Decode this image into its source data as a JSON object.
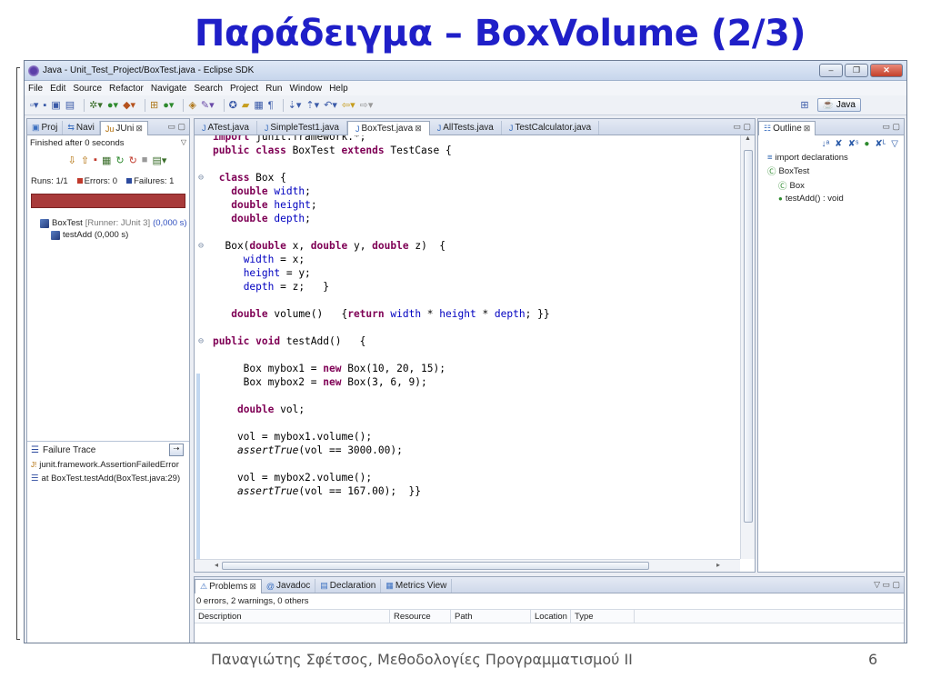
{
  "slide": {
    "title": "Παράδειγμα – BoxVolume  (2/3)",
    "footer": "Παναγιώτης Σφέτσος,  Μεθοδολογίες Προγραμματισμού ΙΙ",
    "page": "6"
  },
  "window": {
    "title": "Java - Unit_Test_Project/BoxTest.java - Eclipse SDK",
    "controls": [
      "–",
      "❐",
      "✕"
    ]
  },
  "menu": [
    "File",
    "Edit",
    "Source",
    "Refactor",
    "Navigate",
    "Search",
    "Project",
    "Run",
    "Window",
    "Help"
  ],
  "perspective": {
    "label": "Java"
  },
  "left_pane": {
    "tabs": [
      {
        "label": "Proj",
        "icon": "project-icon"
      },
      {
        "label": "Navi",
        "icon": "navigator-icon"
      },
      {
        "label": "JUni",
        "icon": "junit-icon"
      }
    ],
    "status": "Finished after 0 seconds",
    "runs": "Runs:  1/1",
    "errors": "Errors:  0",
    "failures": "Failures:  1",
    "bar_color": "#a83a3a",
    "tree": [
      {
        "name": "BoxTest",
        "detail": "[Runner: JUnit 3]",
        "time": "(0,000 s)"
      },
      {
        "name": "testAdd (0,000 s)",
        "detail": "",
        "time": ""
      }
    ],
    "failure_trace": {
      "label": "Failure Trace",
      "lines": [
        "junit.framework.AssertionFailedError",
        "at BoxTest.testAdd(BoxTest.java:29)"
      ]
    }
  },
  "editor": {
    "tabs": [
      "ATest.java",
      "SimpleTest1.java",
      "BoxTest.java",
      "AllTests.java",
      "TestCalculator.java"
    ],
    "active_tab": "BoxTest.java"
  },
  "outline": {
    "tab": "Outline",
    "items": [
      "import declarations",
      "BoxTest",
      "Box",
      "testAdd() : void"
    ]
  },
  "problems": {
    "tabs": [
      "Problems",
      "Javadoc",
      "Declaration",
      "Metrics View"
    ],
    "summary": "0 errors, 2 warnings, 0 others",
    "columns": [
      "Description",
      "Resource",
      "Path",
      "Location",
      "Type"
    ]
  }
}
